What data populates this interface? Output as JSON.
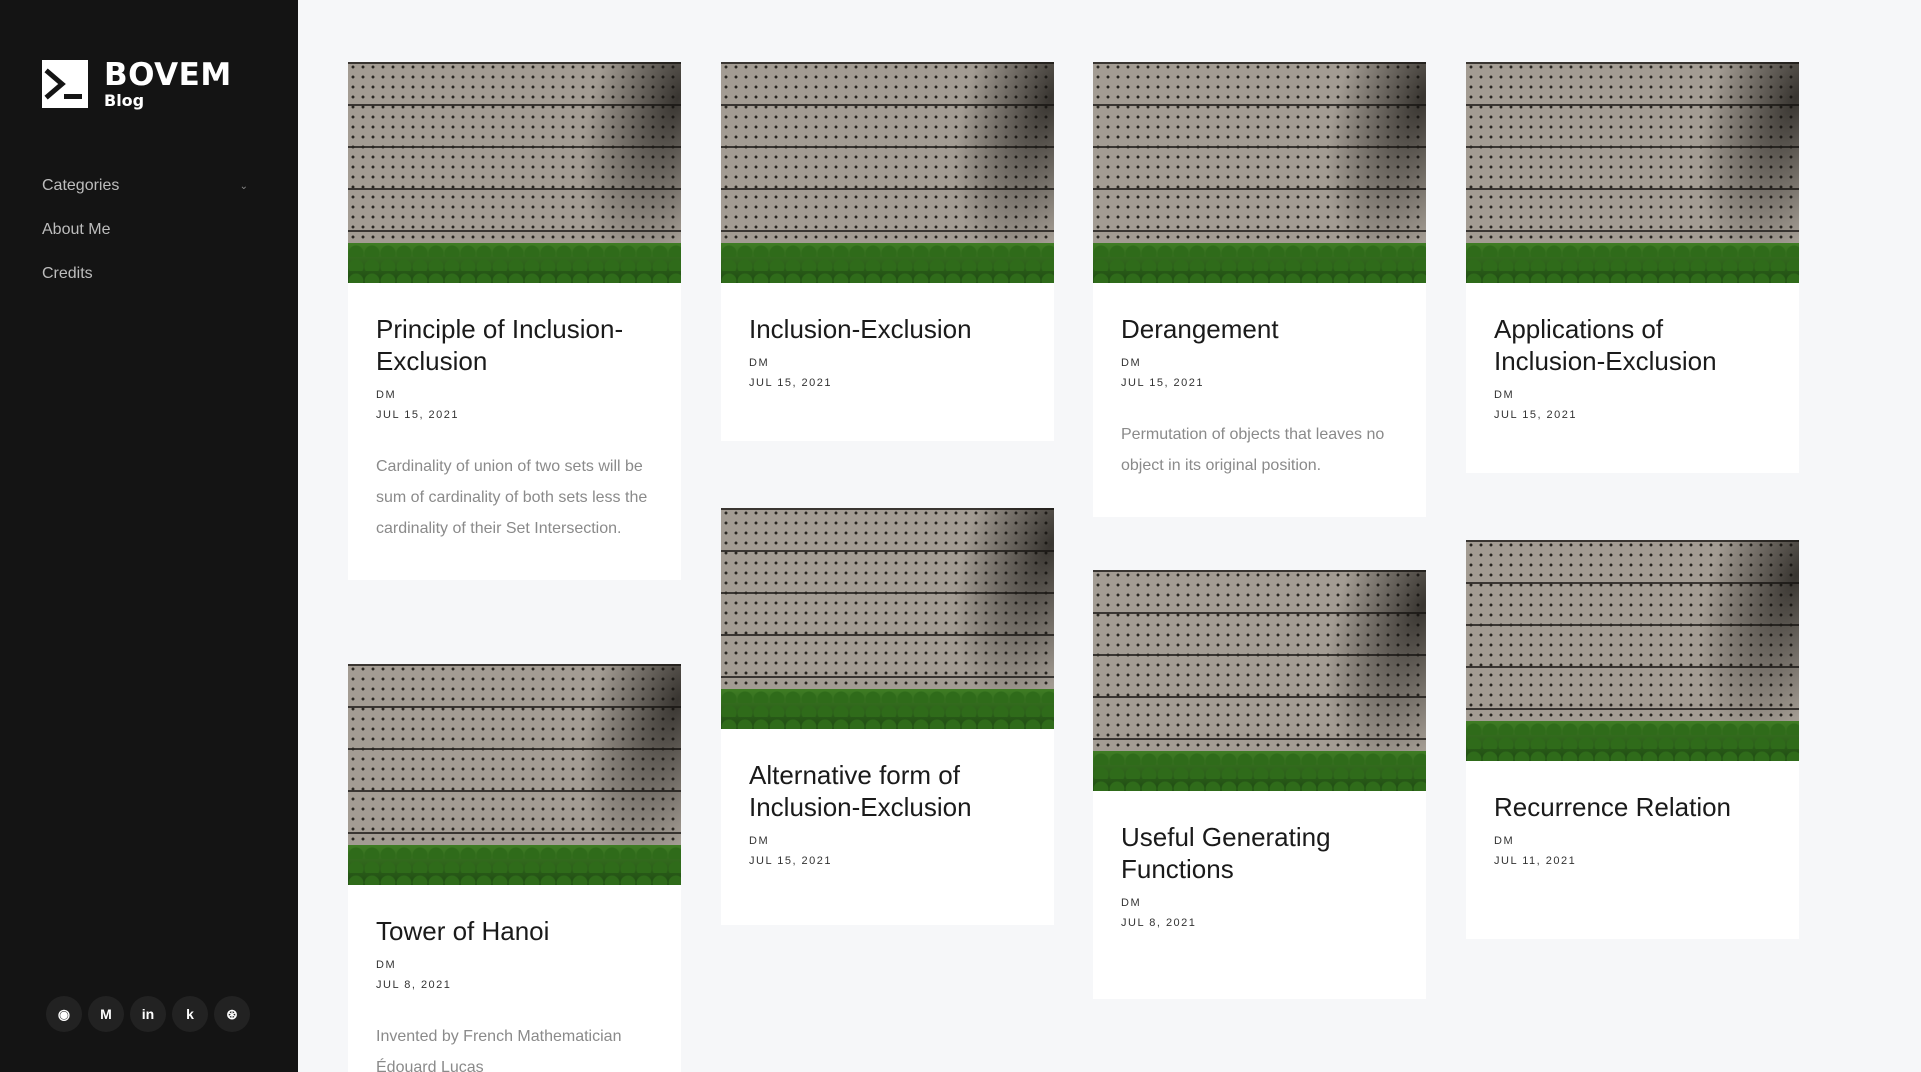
{
  "brand": {
    "title": "BOVEM",
    "subtitle": "Blog"
  },
  "nav": [
    {
      "label": "Categories",
      "has_dropdown": true
    },
    {
      "label": "About Me",
      "has_dropdown": false
    },
    {
      "label": "Credits",
      "has_dropdown": false
    }
  ],
  "social": [
    {
      "icon": "github-icon",
      "glyph": "◉"
    },
    {
      "icon": "medium-icon",
      "glyph": "M"
    },
    {
      "icon": "linkedin-icon",
      "glyph": "in"
    },
    {
      "icon": "kaggle-icon",
      "glyph": "k"
    },
    {
      "icon": "dribbble-icon",
      "glyph": "⊛"
    }
  ],
  "posts": [
    {
      "title": "Principle of Inclusion-Exclusion",
      "author": "DM",
      "date": "JUL 15, 2021",
      "excerpt": "Cardinality of union of two sets will be sum of cardinality of both sets less the cardinality of their Set Intersection."
    },
    {
      "title": "Inclusion-Exclusion",
      "author": "DM",
      "date": "JUL 15, 2021",
      "excerpt": ""
    },
    {
      "title": "Derangement",
      "author": "DM",
      "date": "JUL 15, 2021",
      "excerpt": "Permutation of objects that leaves no object in its original position."
    },
    {
      "title": "Applications of Inclusion-Exclusion",
      "author": "DM",
      "date": "JUL 15, 2021",
      "excerpt": ""
    },
    {
      "title": "Tower of Hanoi",
      "author": "DM",
      "date": "JUL 8, 2021",
      "excerpt": "Invented by French Mathematician Édouard Lucas"
    },
    {
      "title": "Alternative form of Inclusion-Exclusion",
      "author": "DM",
      "date": "JUL 15, 2021",
      "excerpt": ""
    },
    {
      "title": "Useful Generating Functions",
      "author": "DM",
      "date": "JUL 8, 2021",
      "excerpt": ""
    },
    {
      "title": "Recurrence Relation",
      "author": "DM",
      "date": "JUL 11, 2021",
      "excerpt": ""
    }
  ],
  "colors": {
    "sidebar": "#141414",
    "page": "#f6f7f9",
    "card": "#ffffff"
  }
}
